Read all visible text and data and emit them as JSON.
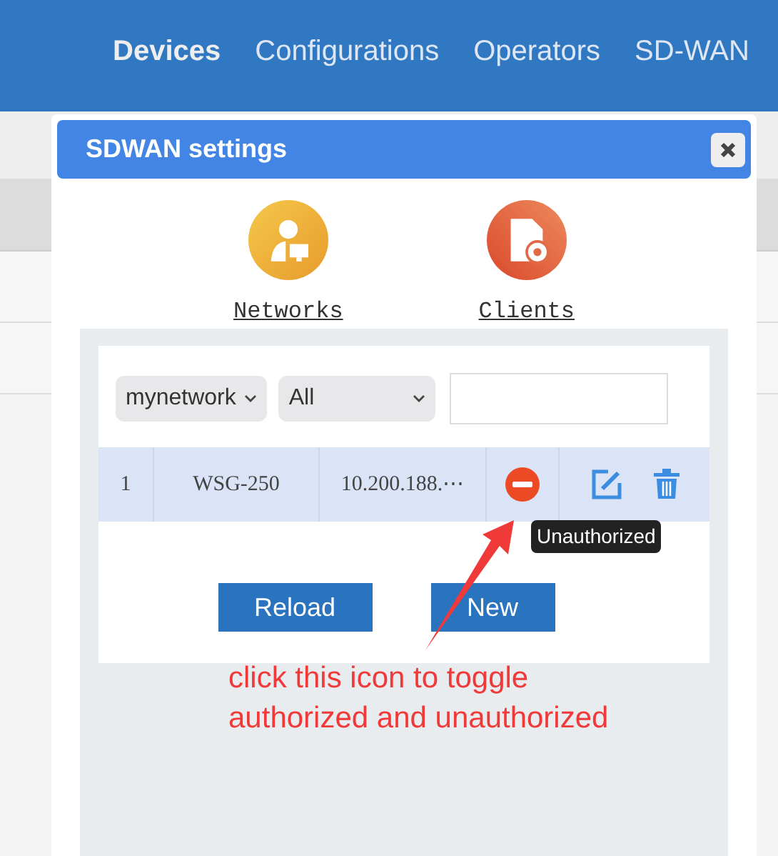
{
  "navbar": {
    "items": [
      {
        "label": "Devices",
        "selected": true
      },
      {
        "label": "Configurations",
        "selected": false
      },
      {
        "label": "Operators",
        "selected": false
      },
      {
        "label": "SD-WAN",
        "selected": false
      }
    ]
  },
  "dialog": {
    "title": "SDWAN settings",
    "sections": [
      {
        "label": "Networks",
        "kind": "networks"
      },
      {
        "label": "Clients",
        "kind": "clients"
      }
    ],
    "filters": {
      "network": "mynetwork",
      "status": "All"
    },
    "rows": [
      {
        "index": "1",
        "name": "WSG-250",
        "address": "10.200.188.⋯",
        "authorized": false,
        "selected": true
      }
    ],
    "tooltip": "Unauthorized",
    "buttons": [
      "Reload",
      "New"
    ]
  },
  "annotation": {
    "text": "click this icon to toggle authorized and unauthorized"
  }
}
